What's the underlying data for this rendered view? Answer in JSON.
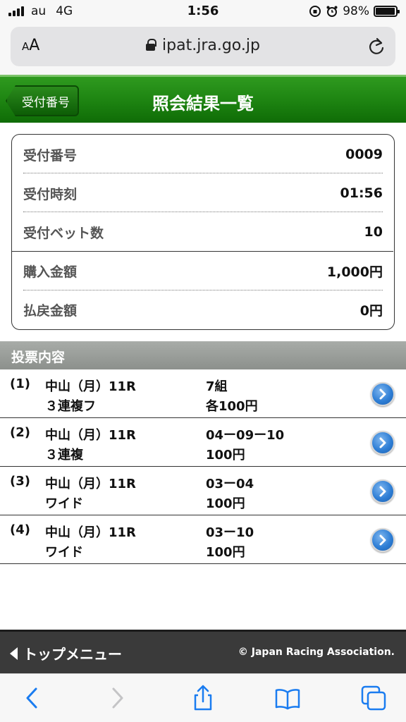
{
  "status": {
    "carrier": "au",
    "network": "4G",
    "time": "1:56",
    "battery": "98%",
    "battery_level": 0.98
  },
  "browser": {
    "text_size": "AA",
    "url": "ipat.jra.go.jp"
  },
  "header": {
    "back_label": "受付番号",
    "title": "照会結果一覧"
  },
  "receipt": {
    "rows": [
      {
        "label": "受付番号",
        "value": "0009"
      },
      {
        "label": "受付時刻",
        "value": "01:56"
      },
      {
        "label": "受付ベット数",
        "value": "10"
      },
      {
        "label": "購入金額",
        "value": "1,000円"
      },
      {
        "label": "払戻金額",
        "value": "0円"
      }
    ]
  },
  "section": {
    "title": "投票内容"
  },
  "tickets": [
    {
      "num": "(1)",
      "venue": "中山（月）11R",
      "type": "３連複フ",
      "combo": "7組",
      "amount": "各100円"
    },
    {
      "num": "(2)",
      "venue": "中山（月）11R",
      "type": "３連複",
      "combo": "04ー09ー10",
      "amount": "100円"
    },
    {
      "num": "(3)",
      "venue": "中山（月）11R",
      "type": "ワイド",
      "combo": "03ー04",
      "amount": "100円"
    },
    {
      "num": "(4)",
      "venue": "中山（月）11R",
      "type": "ワイド",
      "combo": "03ー10",
      "amount": "100円"
    }
  ],
  "footer": {
    "top_menu": "トップメニュー",
    "copyright": "© Japan Racing Association."
  },
  "colors": {
    "header_green": "#1e8512",
    "section_gray": "#9a9e9a",
    "footer_dark": "#3a3a3a",
    "link_blue": "#1a7cf0"
  }
}
